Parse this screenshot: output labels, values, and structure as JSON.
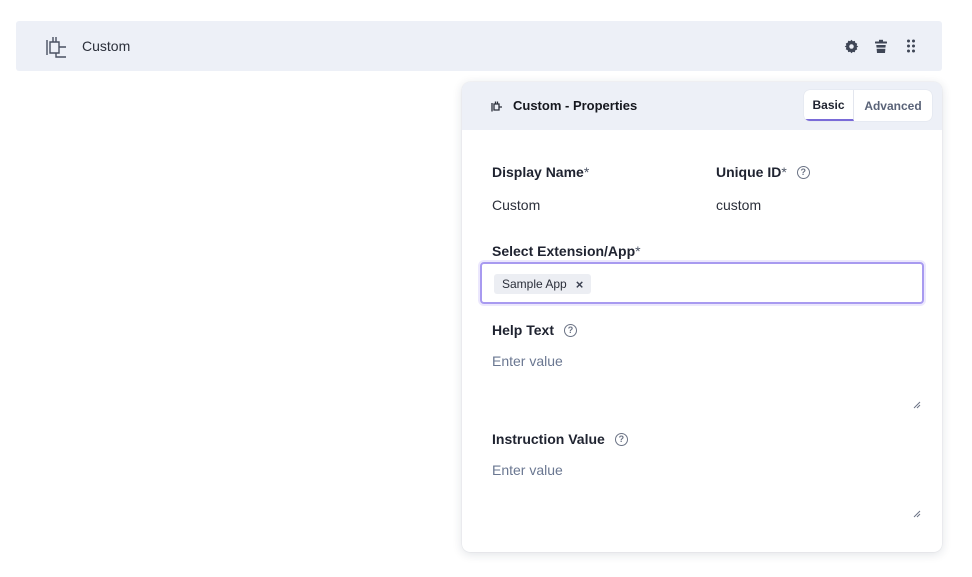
{
  "field": {
    "title": "Custom",
    "icon": "plug-icon"
  },
  "toolbar": {
    "settings_icon": "gear-icon",
    "delete_icon": "trash-icon",
    "drag_icon": "drag-handle-icon"
  },
  "panel": {
    "title": "Custom - Properties",
    "tabs": [
      {
        "label": "Basic",
        "active": true
      },
      {
        "label": "Advanced",
        "active": false
      }
    ],
    "display_name": {
      "label": "Display Name",
      "required_mark": "*",
      "value": "Custom"
    },
    "unique_id": {
      "label": "Unique ID",
      "required_mark": "*",
      "value": "custom"
    },
    "extension": {
      "label": "Select Extension/App",
      "required_mark": "*",
      "selected": "Sample App",
      "remove_glyph": "×"
    },
    "help_text": {
      "label": "Help Text",
      "placeholder": "Enter value"
    },
    "instruction_value": {
      "label": "Instruction Value",
      "placeholder": "Enter value"
    }
  },
  "colors": {
    "bar_background": "#edf0f7",
    "accent": "#7a6bd8",
    "focus_border": "#a89af0",
    "placeholder": "#6a7791"
  }
}
